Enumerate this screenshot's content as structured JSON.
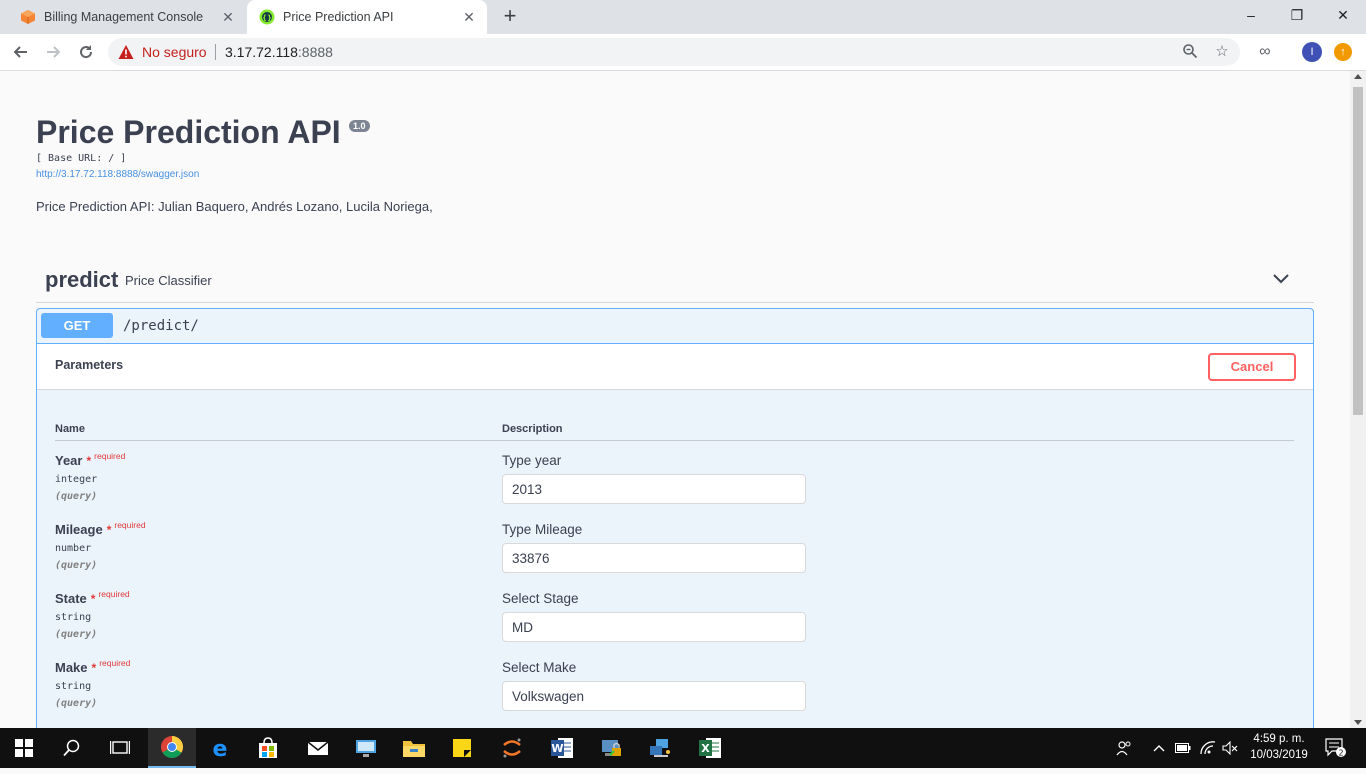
{
  "browser": {
    "tabs": [
      {
        "title": "Billing Management Console",
        "active": false
      },
      {
        "title": "Price Prediction API",
        "active": true
      }
    ],
    "new_tab": "+",
    "window": {
      "minimize": "–",
      "restore": "❐",
      "close": "✕"
    },
    "address": {
      "security": "No seguro",
      "host": "3.17.72.118",
      "port": ":8888"
    },
    "profile_initial": "I"
  },
  "api": {
    "title": "Price Prediction API",
    "version": "1.0",
    "base_url": "[ Base URL: / ]",
    "spec_link": "http://3.17.72.118:8888/swagger.json",
    "description": "Price Prediction API: Julian Baquero, Andrés Lozano, Lucila Noriega,"
  },
  "tag": {
    "name": "predict",
    "description": "Price Classifier"
  },
  "operation": {
    "method": "GET",
    "path": "/predict/",
    "parameters_title": "Parameters",
    "cancel_label": "Cancel",
    "columns": {
      "name": "Name",
      "description": "Description"
    },
    "params": [
      {
        "name": "Year",
        "required": "required",
        "type": "integer",
        "in": "(query)",
        "description": "Type year",
        "value": "2013"
      },
      {
        "name": "Mileage",
        "required": "required",
        "type": "number",
        "in": "(query)",
        "description": "Type Mileage",
        "value": "33876"
      },
      {
        "name": "State",
        "required": "required",
        "type": "string",
        "in": "(query)",
        "description": "Select Stage",
        "value": "MD"
      },
      {
        "name": "Make",
        "required": "required",
        "type": "string",
        "in": "(query)",
        "description": "Select Make",
        "value": "Volkswagen"
      }
    ]
  },
  "taskbar": {
    "time": "4:59 p. m.",
    "date": "10/03/2019",
    "notifications": "2"
  },
  "colors": {
    "get_accent": "#61affe",
    "required_red": "#e03b3b",
    "cancel_red": "#ff6060"
  }
}
